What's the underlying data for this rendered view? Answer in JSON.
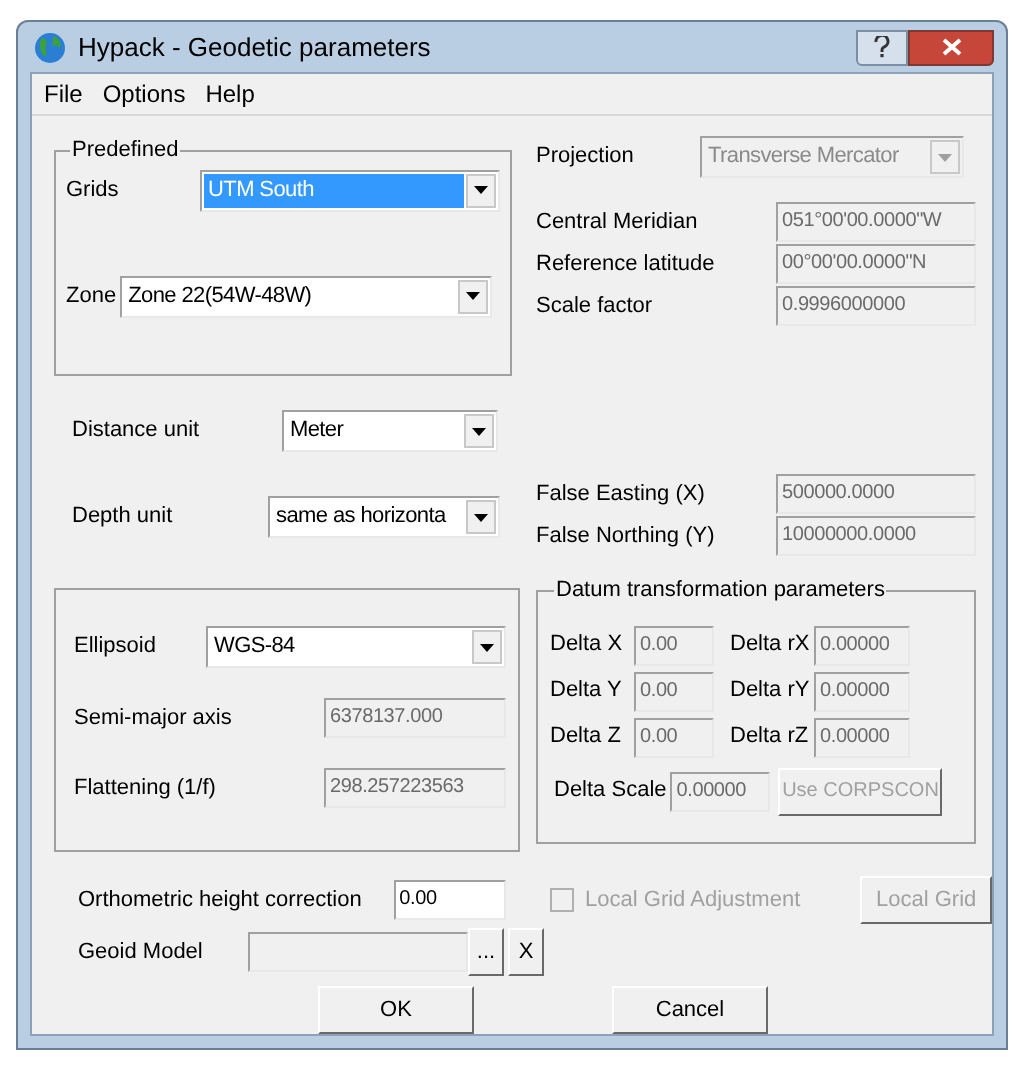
{
  "window": {
    "title": "Hypack - Geodetic parameters"
  },
  "menu": [
    "File",
    "Options",
    "Help"
  ],
  "predefined": {
    "title": "Predefined",
    "grids": {
      "label": "Grids",
      "value": "UTM South",
      "highlighted": true
    },
    "zone": {
      "label": "Zone",
      "value": "Zone 22(54W-48W)"
    }
  },
  "projection": {
    "label": "Projection",
    "value": "Transverse Mercator",
    "disabled": true
  },
  "projection_params": [
    {
      "label": "Central Meridian",
      "value": "051°00'00.0000\"W",
      "disabled": true
    },
    {
      "label": "Reference latitude",
      "value": "00°00'00.0000\"N",
      "disabled": true
    },
    {
      "label": "Scale factor",
      "value": "0.9996000000",
      "disabled": true
    }
  ],
  "distance_unit": {
    "label": "Distance unit",
    "value": "Meter"
  },
  "depth_unit": {
    "label": "Depth unit",
    "value": "same as horizonta"
  },
  "false_origin": [
    {
      "label": "False Easting (X)",
      "value": "500000.0000",
      "disabled": true
    },
    {
      "label": "False Northing (Y)",
      "value": "10000000.0000",
      "disabled": true
    }
  ],
  "ellipsoid": {
    "label": "Ellipsoid",
    "value": "WGS-84",
    "fields": [
      {
        "label": "Semi-major axis",
        "value": "6378137.000",
        "disabled": true
      },
      {
        "label": "Flattening (1/f)",
        "value": "298.257223563",
        "disabled": true
      }
    ]
  },
  "datum": {
    "title": "Datum transformation parameters",
    "rows": [
      [
        {
          "label": "Delta X",
          "value": "0.00",
          "disabled": true
        },
        {
          "label": "Delta rX",
          "value": "0.00000",
          "disabled": true
        }
      ],
      [
        {
          "label": "Delta Y",
          "value": "0.00",
          "disabled": true
        },
        {
          "label": "Delta rY",
          "value": "0.00000",
          "disabled": true
        }
      ],
      [
        {
          "label": "Delta Z",
          "value": "0.00",
          "disabled": true
        },
        {
          "label": "Delta rZ",
          "value": "0.00000",
          "disabled": true
        }
      ]
    ],
    "scale": {
      "label": "Delta Scale",
      "value": "0.00000",
      "disabled": true
    },
    "corpscon": {
      "label": "Use CORPSCON",
      "disabled": true
    }
  },
  "orthometric": {
    "label": "Orthometric height correction",
    "value": "0.00",
    "disabled": false
  },
  "local_grid_adjustment": {
    "label": "Local Grid Adjustment",
    "checked": false,
    "disabled": true
  },
  "local_grid_button": {
    "label": "Local Grid",
    "disabled": true
  },
  "geoid": {
    "label": "Geoid Model",
    "browse": "...",
    "clear": "X"
  },
  "buttons": [
    "OK",
    "Cancel"
  ]
}
